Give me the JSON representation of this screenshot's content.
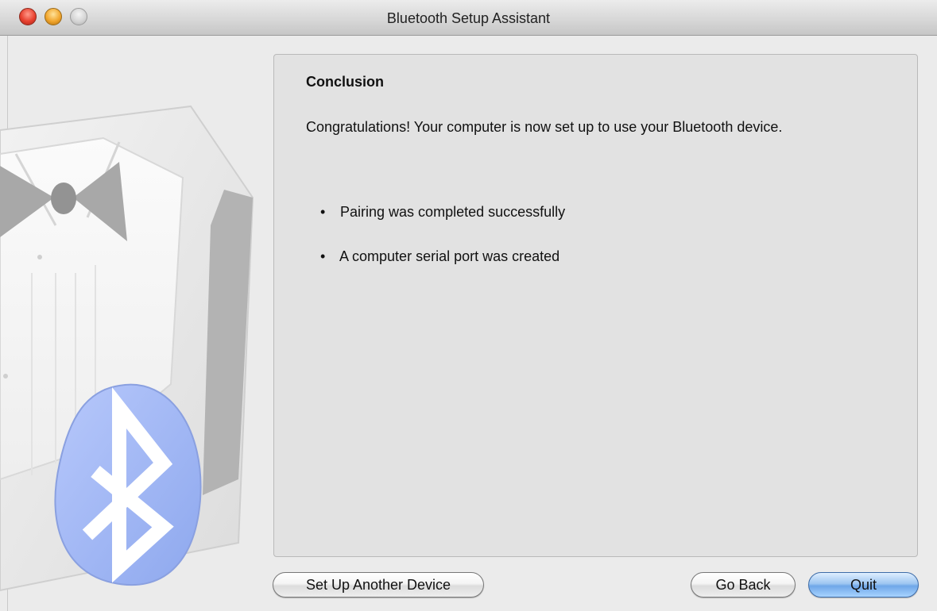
{
  "window": {
    "title": "Bluetooth Setup Assistant"
  },
  "panel": {
    "heading": "Conclusion",
    "message": "Congratulations! Your computer is now set up to use your Bluetooth device.",
    "results": [
      {
        "bullet": "•",
        "text": "Pairing was completed successfully"
      },
      {
        "bullet": "•",
        "text": "A computer serial port was created"
      }
    ]
  },
  "buttons": {
    "setup_another": "Set Up Another Device",
    "go_back": "Go Back",
    "quit": "Quit"
  },
  "icons": {
    "close": "close-button-icon",
    "minimize": "minimize-button-icon",
    "zoom": "zoom-button-icon",
    "bluetooth": "bluetooth-icon",
    "assistant": "tuxedo-assistant-illustration"
  },
  "colors": {
    "close": "#e8402e",
    "minimize": "#f1a52c",
    "zoom": "#d2d2d2",
    "bluetooth_badge": "#9fb6f5",
    "default_button": "#6fa7e8"
  }
}
